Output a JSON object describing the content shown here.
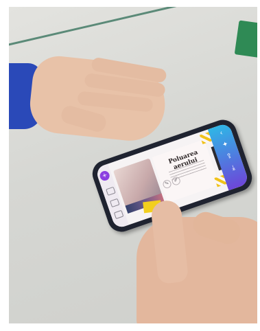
{
  "scene": {
    "description": "",
    "phone_screen": {
      "title": "Poluarea aerului",
      "toolbar_top_icons": [
        "back-icon",
        "sparkle-icon",
        "share-icon",
        "download-icon"
      ],
      "toolbar_left_icons": [
        "add-icon",
        "image-tool-icon",
        "text-tool-icon",
        "elements-tool-icon"
      ]
    }
  }
}
